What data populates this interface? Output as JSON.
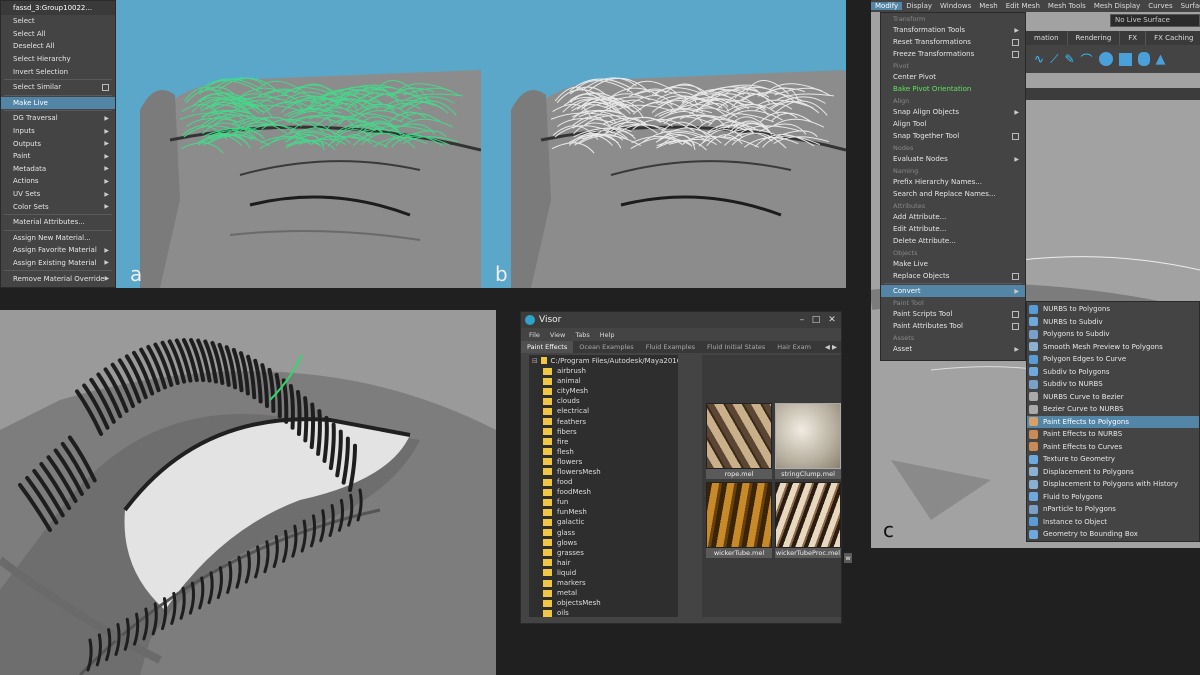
{
  "menu_a": {
    "title": "fassd_3:Group10022...",
    "items": [
      {
        "label": "Select"
      },
      {
        "label": "Select All"
      },
      {
        "label": "Deselect All"
      },
      {
        "label": "Select Hierarchy"
      },
      {
        "label": "Invert Selection"
      },
      {
        "sep": true
      },
      {
        "label": "Select Similar",
        "box": true
      },
      {
        "sep": true
      },
      {
        "label": "Make Live",
        "hl": true
      },
      {
        "sep": true
      },
      {
        "label": "DG Traversal",
        "arrow": true
      },
      {
        "label": "Inputs",
        "arrow": true
      },
      {
        "label": "Outputs",
        "arrow": true
      },
      {
        "label": "Paint",
        "arrow": true
      },
      {
        "label": "Metadata",
        "arrow": true
      },
      {
        "label": "Actions",
        "arrow": true
      },
      {
        "label": "UV Sets",
        "arrow": true
      },
      {
        "label": "Color Sets",
        "arrow": true
      },
      {
        "sep": true
      },
      {
        "label": "Material Attributes..."
      },
      {
        "sep": true
      },
      {
        "label": "Assign New Material..."
      },
      {
        "label": "Assign Favorite Material",
        "arrow": true
      },
      {
        "label": "Assign Existing Material",
        "arrow": true
      },
      {
        "sep": true
      },
      {
        "label": "Remove Material Override",
        "arrow": true
      }
    ]
  },
  "labels": {
    "a": "a",
    "b": "b",
    "c": "c"
  },
  "menubar_c": [
    "Modify",
    "Display",
    "Windows",
    "Mesh",
    "Edit Mesh",
    "Mesh Tools",
    "Mesh Display",
    "Curves",
    "Surfaces"
  ],
  "menubar_active": "Modify",
  "live_surface": "No Live Surface",
  "shelf_tabs": [
    "mation",
    "Rendering",
    "FX",
    "FX Caching"
  ],
  "modify_menu": [
    {
      "section": "Transform"
    },
    {
      "label": "Transformation Tools",
      "arrow": true
    },
    {
      "label": "Reset Transformations",
      "box": true
    },
    {
      "label": "Freeze Transformations",
      "box": true
    },
    {
      "section": "Pivot"
    },
    {
      "label": "Center Pivot"
    },
    {
      "label": "Bake Pivot Orientation",
      "green": true
    },
    {
      "section": "Align"
    },
    {
      "label": "Snap Align Objects",
      "arrow": true
    },
    {
      "label": "Align Tool"
    },
    {
      "label": "Snap Together Tool",
      "box": true
    },
    {
      "section": "Nodes"
    },
    {
      "label": "Evaluate Nodes",
      "arrow": true
    },
    {
      "section": "Naming"
    },
    {
      "label": "Prefix Hierarchy Names..."
    },
    {
      "label": "Search and Replace Names..."
    },
    {
      "section": "Attributes"
    },
    {
      "label": "Add Attribute..."
    },
    {
      "label": "Edit Attribute..."
    },
    {
      "label": "Delete Attribute..."
    },
    {
      "section": "Objects"
    },
    {
      "label": "Make Live"
    },
    {
      "label": "Replace Objects",
      "box": true
    },
    {
      "sep": true
    },
    {
      "label": "Convert",
      "arrow": true,
      "hl": true
    },
    {
      "section": "Paint Tool"
    },
    {
      "label": "Paint Scripts Tool",
      "box": true
    },
    {
      "label": "Paint Attributes Tool",
      "box": true
    },
    {
      "section": "Assets"
    },
    {
      "label": "Asset",
      "arrow": true
    }
  ],
  "convert_menu": [
    {
      "label": "NURBS to Polygons"
    },
    {
      "label": "NURBS to Subdiv"
    },
    {
      "label": "Polygons to Subdiv"
    },
    {
      "label": "Smooth Mesh Preview to Polygons"
    },
    {
      "label": "Polygon Edges to Curve"
    },
    {
      "label": "Subdiv to Polygons"
    },
    {
      "label": "Subdiv to NURBS"
    },
    {
      "label": "NURBS Curve to Bezier"
    },
    {
      "label": "Bezier Curve to NURBS"
    },
    {
      "label": "Paint Effects to Polygons",
      "hl": true
    },
    {
      "label": "Paint Effects to NURBS"
    },
    {
      "label": "Paint Effects to Curves"
    },
    {
      "label": "Texture to Geometry"
    },
    {
      "label": "Displacement to Polygons"
    },
    {
      "label": "Displacement to Polygons with History"
    },
    {
      "label": "Fluid to Polygons"
    },
    {
      "label": "nParticle to Polygons"
    },
    {
      "label": "Instance to Object"
    },
    {
      "label": "Geometry to Bounding Box"
    }
  ],
  "visor": {
    "title": "Visor",
    "menu": [
      "File",
      "View",
      "Tabs",
      "Help"
    ],
    "tabs": [
      "Paint Effects",
      "Ocean Examples",
      "Fluid Examples",
      "Fluid Initial States",
      "Hair Exam"
    ],
    "path": "C:/Program Files/Autodesk/Maya2016/b",
    "folders": [
      "airbrush",
      "animal",
      "cityMesh",
      "clouds",
      "electrical",
      "feathers",
      "fibers",
      "fire",
      "flesh",
      "flowers",
      "flowersMesh",
      "food",
      "foodMesh",
      "fun",
      "funMesh",
      "galactic",
      "glass",
      "glows",
      "grasses",
      "hair",
      "liquid",
      "markers",
      "metal",
      "objectsMesh",
      "oils"
    ],
    "thumbs": [
      "rope.mel",
      "stringClump.mel",
      "wickerTube.mel",
      "wickerTubeProc.mel"
    ],
    "thumb_overflow": "w"
  }
}
